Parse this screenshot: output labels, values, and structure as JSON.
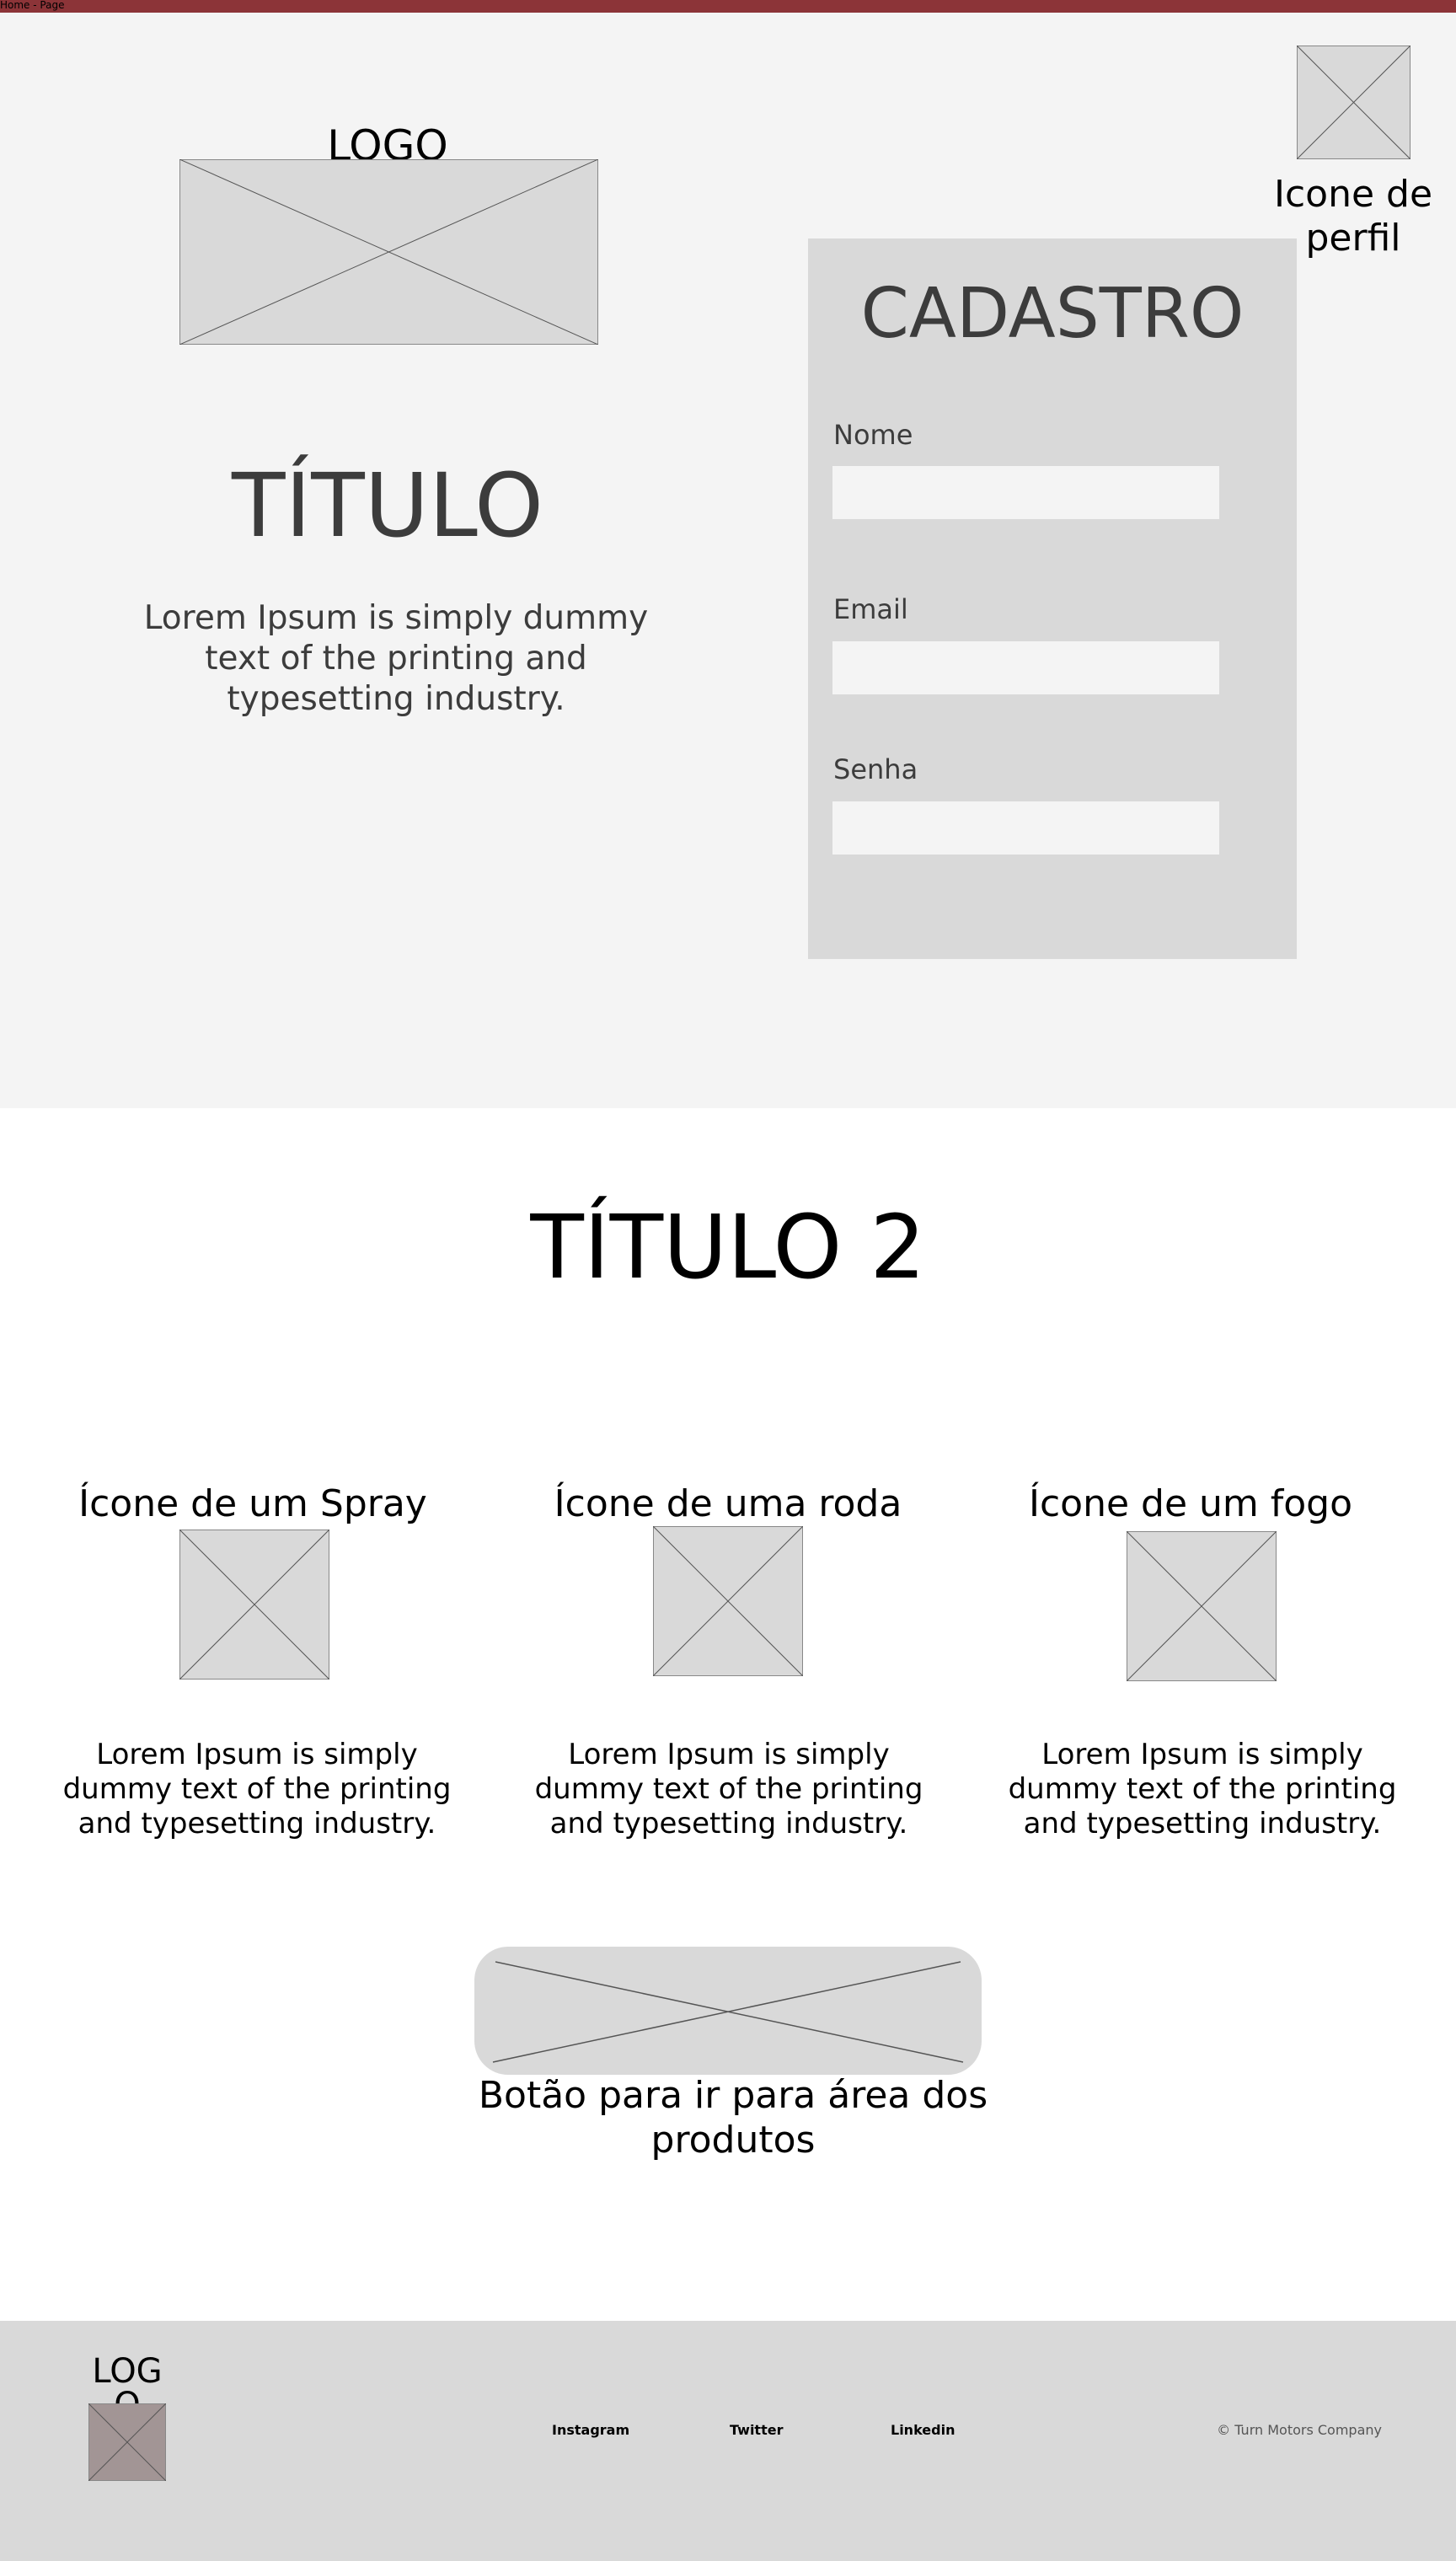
{
  "topbar": {
    "breadcrumb": "Home - Page",
    "color": "#8c3438"
  },
  "hero": {
    "logo_label": "LOGO",
    "title": "TÍTULO",
    "body": "Lorem Ipsum is simply dummy text of the printing and typesetting industry.",
    "profile_label": "Icone de perfil"
  },
  "signup": {
    "title": "CADASTRO",
    "fields": [
      {
        "label": "Nome",
        "value": ""
      },
      {
        "label": "Email",
        "value": ""
      },
      {
        "label": "Senha",
        "value": ""
      }
    ]
  },
  "section2": {
    "title": "TÍTULO 2",
    "features": [
      {
        "label": "Ícone de um Spray",
        "icon": "spray-icon",
        "body": "Lorem Ipsum is simply dummy text of the printing and typesetting industry."
      },
      {
        "label": "Ícone de uma roda",
        "icon": "wheel-icon",
        "body": "Lorem Ipsum is simply dummy text of the printing and typesetting industry."
      },
      {
        "label": "Ícone de um fogo",
        "icon": "fire-icon",
        "body": "Lorem Ipsum is simply dummy text of the printing and typesetting industry."
      }
    ],
    "cta_label": "Botão para ir para área dos produtos"
  },
  "footer": {
    "logo_label": "LOGO",
    "links": [
      "Instagram",
      "Twitter",
      "Linkedin"
    ],
    "copyright": "© Turn Motors Company"
  },
  "colors": {
    "hero_bg": "#f4f4f4",
    "placeholder": "#d9d9d9",
    "footer_logo": "#a29595",
    "text_dark": "#3c3c3c"
  }
}
